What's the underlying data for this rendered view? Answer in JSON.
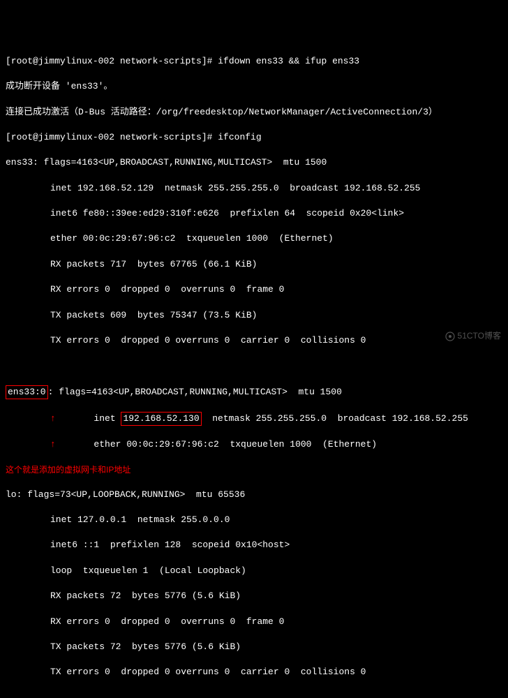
{
  "prompt1": "[root@jimmylinux-002 network-scripts]# ",
  "cmd1": "ifdown ens33 && ifup ens33",
  "msg1": "成功断开设备 'ens33'。",
  "msg2": "连接已成功激活（D-Bus 活动路径：/org/freedesktop/NetworkManager/ActiveConnection/3）",
  "prompt2": "[root@jimmylinux-002 network-scripts]# ",
  "cmd2": "ifconfig",
  "ens33": {
    "header": "ens33: flags=4163<UP,BROADCAST,RUNNING,MULTICAST>  mtu 1500",
    "inet": "inet 192.168.52.129  netmask 255.255.255.0  broadcast 192.168.52.255",
    "inet6": "inet6 fe80::39ee:ed29:310f:e626  prefixlen 64  scopeid 0x20<link>",
    "ether": "ether 00:0c:29:67:96:c2  txqueuelen 1000  (Ethernet)",
    "rxp": "RX packets 717  bytes 67765 (66.1 KiB)",
    "rxe": "RX errors 0  dropped 0  overruns 0  frame 0",
    "txp": "TX packets 609  bytes 75347 (73.5 KiB)",
    "txe": "TX errors 0  dropped 0 overruns 0  carrier 0  collisions 0"
  },
  "ens33_0": {
    "name": "ens33:0",
    "header_rest": ": flags=4163<UP,BROADCAST,RUNNING,MULTICAST>  mtu 1500",
    "inet_pre": "inet ",
    "ip": "192.168.52.130",
    "inet_post": "  netmask 255.255.255.0  broadcast 192.168.52.255",
    "ether": "ether 00:0c:29:67:96:c2  txqueuelen 1000  (Ethernet)"
  },
  "annotation": "这个就是添加的虚拟网卡和IP地址",
  "lo": {
    "header": "lo: flags=73<UP,LOOPBACK,RUNNING>  mtu 65536",
    "inet": "inet 127.0.0.1  netmask 255.0.0.0",
    "inet6": "inet6 ::1  prefixlen 128  scopeid 0x10<host>",
    "loop": "loop  txqueuelen 1  (Local Loopback)",
    "rxp": "RX packets 72  bytes 5776 (5.6 KiB)",
    "rxe": "RX errors 0  dropped 0  overruns 0  frame 0",
    "txp": "TX packets 72  bytes 5776 (5.6 KiB)",
    "txe": "TX errors 0  dropped 0 overruns 0  carrier 0  collisions 0"
  },
  "watermark": "51CTO博客"
}
